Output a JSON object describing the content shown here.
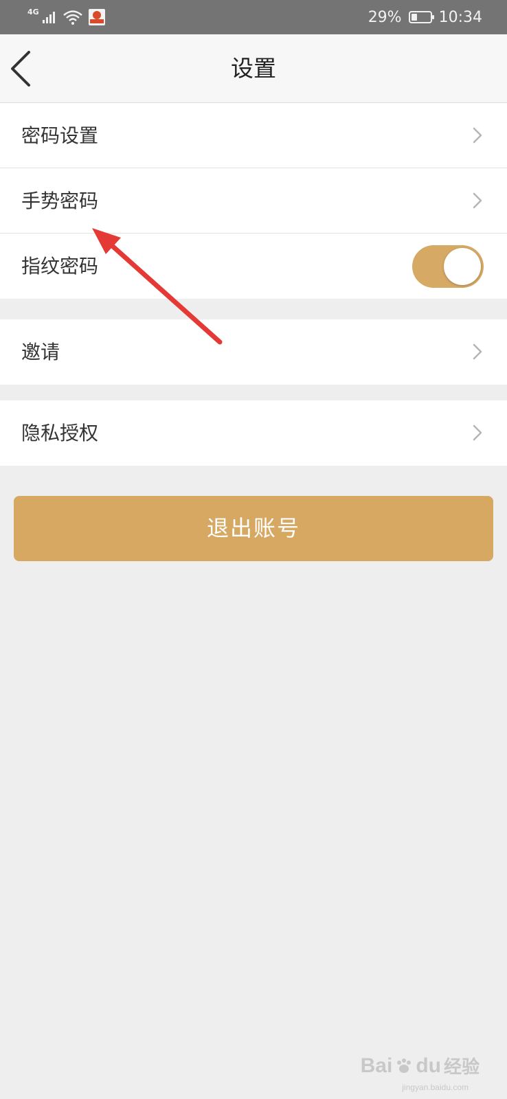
{
  "status_bar": {
    "network": "4G",
    "battery_text": "29%",
    "battery_level": 0.29,
    "time": "10:34"
  },
  "nav": {
    "title": "设置"
  },
  "groups": [
    {
      "items": [
        {
          "label": "密码设置",
          "type": "link"
        },
        {
          "label": "手势密码",
          "type": "link"
        },
        {
          "label": "指纹密码",
          "type": "toggle",
          "on": true
        }
      ]
    },
    {
      "items": [
        {
          "label": "邀请",
          "type": "link"
        }
      ]
    },
    {
      "items": [
        {
          "label": "隐私授权",
          "type": "link"
        }
      ]
    }
  ],
  "logout_label": "退出账号",
  "watermark": {
    "brand_a": "Bai",
    "brand_b": "du",
    "brand_cn": "经验",
    "url": "jingyan.baidu.com"
  },
  "colors": {
    "accent": "#d6a862",
    "annotation_arrow": "#e53935",
    "background": "#eeeeee"
  }
}
